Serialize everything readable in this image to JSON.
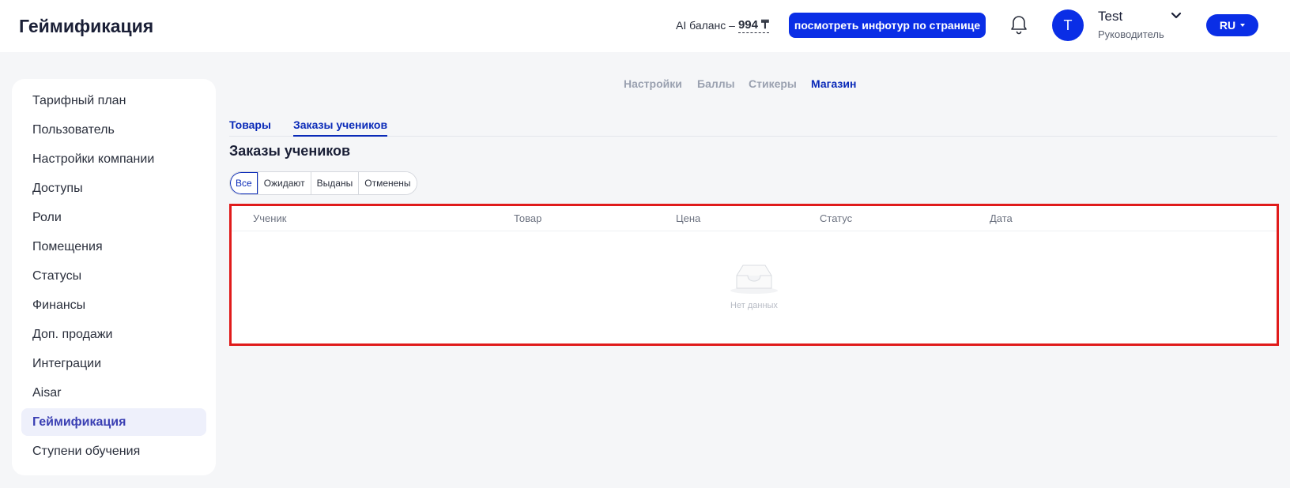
{
  "header": {
    "title": "Геймификация",
    "ai_balance_label": "AI баланс –",
    "ai_balance_value": "994 ₸",
    "tour_button_label": "посмотреть инфотур по странице",
    "user_initial": "T",
    "user_name": "Test",
    "user_role": "Руководитель",
    "language": "RU"
  },
  "sidebar": {
    "items": [
      {
        "label": "Тарифный план"
      },
      {
        "label": "Пользователь"
      },
      {
        "label": "Настройки компании"
      },
      {
        "label": "Доступы"
      },
      {
        "label": "Роли"
      },
      {
        "label": "Помещения"
      },
      {
        "label": "Статусы"
      },
      {
        "label": "Финансы"
      },
      {
        "label": "Доп. продажи"
      },
      {
        "label": "Интеграции"
      },
      {
        "label": "Aisar"
      },
      {
        "label": "Геймификация"
      },
      {
        "label": "Ступени обучения"
      }
    ],
    "active_index": 11
  },
  "top_tabs": {
    "items": [
      {
        "label": "Настройки"
      },
      {
        "label": "Баллы"
      },
      {
        "label": "Стикеры"
      },
      {
        "label": "Магазин"
      }
    ],
    "active_index": 3
  },
  "sub_tabs": {
    "items": [
      {
        "label": "Товары"
      },
      {
        "label": "Заказы учеников"
      }
    ],
    "active_index": 1
  },
  "section_title": "Заказы учеников",
  "filters": {
    "items": [
      {
        "label": "Все"
      },
      {
        "label": "Ожидают"
      },
      {
        "label": "Выданы"
      },
      {
        "label": "Отменены"
      }
    ],
    "active_index": 0
  },
  "table": {
    "columns": [
      "Ученик",
      "Товар",
      "Цена",
      "Статус",
      "Дата"
    ],
    "empty_text": "Нет данных"
  },
  "colors": {
    "accent": "#0a2ee6",
    "active_text": "#0a2ab8",
    "highlight_border": "#e01b1b"
  },
  "icons": {
    "bell": "bell-icon",
    "chevron": "chevron-down-icon",
    "empty": "empty-inbox-icon"
  }
}
